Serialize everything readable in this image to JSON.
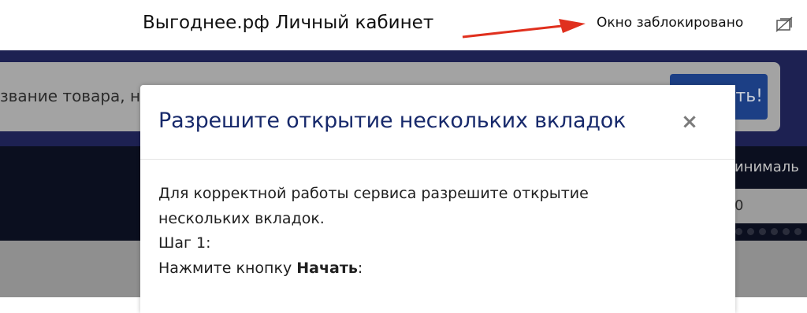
{
  "annotation": {
    "title": "Выгоднее.рф Личный кабинет",
    "blocked_text": "Окно заблокировано",
    "arrow_color": "#e0301e"
  },
  "page": {
    "search_placeholder": "звание товара, н",
    "search_button": "ть!",
    "min_label": "инималь",
    "min_value": "0"
  },
  "modal": {
    "title": "Разрешите открытие нескольких вкладок",
    "close": "×",
    "line1": "Для корректной работы сервиса разрешите открытие",
    "line2": "нескольких вкладок.",
    "step": "Шаг 1:",
    "instruction_prefix": "Нажмите кнопку ",
    "instruction_bold": "Начать",
    "instruction_suffix": ":"
  },
  "colors": {
    "header": "#1d2152",
    "nav": "#0b0f1f",
    "modal_title": "#17296b",
    "search_button": "#1c3f85"
  }
}
